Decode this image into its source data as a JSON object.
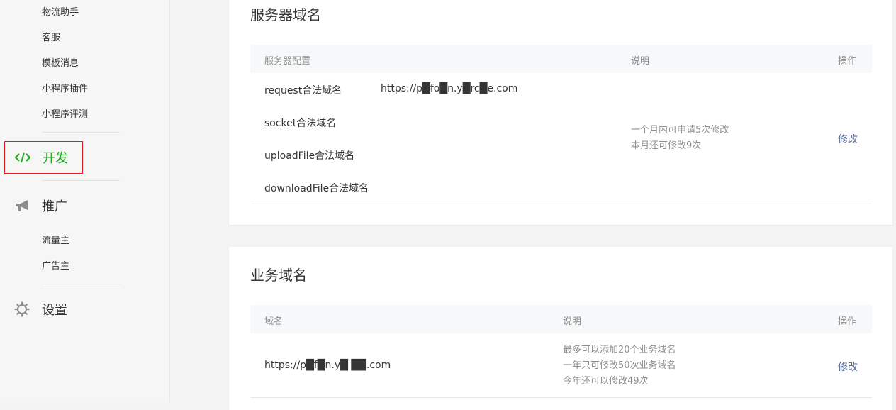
{
  "sidebar": {
    "sub_items_top": [
      "物流助手",
      "客服",
      "模板消息",
      "小程序插件",
      "小程序评测"
    ],
    "dev": {
      "label": "开发"
    },
    "promo": {
      "label": "推广",
      "items": [
        "流量主",
        "广告主"
      ]
    },
    "settings": {
      "label": "设置"
    }
  },
  "server_domain": {
    "title": "服务器域名",
    "headers": {
      "config": "服务器配置",
      "desc": "说明",
      "op": "操作"
    },
    "rows": [
      {
        "name": "request合法域名",
        "value": "https://p█fo█n.y█rc█e.com"
      },
      {
        "name": "socket合法域名",
        "value": ""
      },
      {
        "name": "uploadFile合法域名",
        "value": ""
      },
      {
        "name": "downloadFile合法域名",
        "value": ""
      }
    ],
    "desc_lines": [
      "一个月内可申请5次修改",
      "本月还可修改9次"
    ],
    "edit": "修改"
  },
  "business_domain": {
    "title": "业务域名",
    "headers": {
      "domain": "域名",
      "desc": "说明",
      "op": "操作"
    },
    "value": "https://p█f█n.y█ ██.com",
    "desc_lines": [
      "最多可以添加20个业务域名",
      "一年只可修改50次业务域名",
      "今年还可以修改49次"
    ],
    "edit": "修改"
  }
}
